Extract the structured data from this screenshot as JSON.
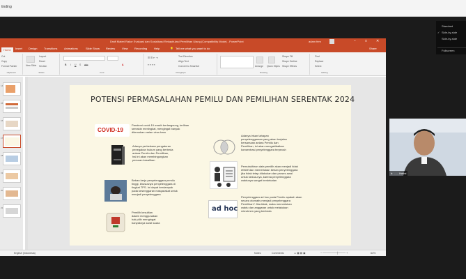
{
  "meeting": {
    "share_label": "tinding",
    "view_menu": [
      "Standard",
      "Side-by-side",
      "Side-by-side",
      "Fullscreen"
    ]
  },
  "ppt": {
    "window_title": "Draft Materi Rakor Evaluasi dan Sosialisasi Rekapitulasi Pemilihan Ulang (Compatibility Mode) - PowerPoint",
    "user_name": "adam fem",
    "window_controls": [
      "−",
      "□",
      "✕"
    ],
    "menu": [
      "File",
      "Home",
      "Insert",
      "Design",
      "Transitions",
      "Animations",
      "Slide Show",
      "Review",
      "View",
      "Recording",
      "Help",
      "Tell me what you want to do"
    ],
    "share": "Share",
    "ribbon": {
      "clipboard": [
        "Cut",
        "Copy",
        "Format Painter"
      ],
      "clipboard_label": "Clipboard",
      "slides": [
        "Layout",
        "Reset",
        "Section"
      ],
      "new_slide": "New Slide",
      "slides_label": "Slides",
      "font_label": "Font",
      "paragraph": [
        "Text Direction",
        "Align Text",
        "Convert to SmartArt"
      ],
      "paragraph_label": "Paragraph",
      "drawing": [
        "Arrange",
        "Quick Styles",
        "Shape Fill",
        "Shape Outline",
        "Shape Effects"
      ],
      "drawing_label": "Drawing",
      "editing": [
        "Find",
        "Replace",
        "Select"
      ],
      "editing_label": "Editing"
    },
    "status": {
      "lang": "English (Indonesia)",
      "notes": "Notes",
      "comments": "Comments",
      "zoom": "64%"
    },
    "thumb_numbers": [
      "14",
      "15",
      "16",
      "17",
      "18",
      "19",
      "20",
      "21"
    ]
  },
  "slide": {
    "title": "POTENSI PERMASALAHAN PEMILU DAN PEMILIHAN SERENTAK 2024",
    "covid_logo": "COVID-19",
    "adhoc_logo": "ad hoc",
    "items_left": [
      {
        "lines": [
          "Pandemi covid-19 masih berlangsung, terlihan",
          "semakin meningkat, mengingat banyak",
          "ditemukan varian virus baru"
        ]
      },
      {
        "lines": [
          "Adanya perbedaan pengaturan",
          "penegakan hukum yang berbeda",
          "antara Pemilu dan Pemilihan,",
          "hal ini akan membingungkan",
          "persoan kesalihan"
        ]
      },
      {
        "lines": [
          "Beban kerja penyelenggara pemilu",
          "tinggi, khususnya penyelenggara di",
          "tingkat TPS. Ini dapat berdampak",
          "pada kesenggaran masyarakat untuk",
          "menjadi penyelenggara"
        ]
      },
      {
        "lines": [
          "Pemilih kesulitan",
          "dalam menggunakan",
          "hak pilih mengingat",
          "banyaknya surat suara"
        ]
      }
    ],
    "items_right": [
      {
        "lines": [
          "Adanya irisan tahapan",
          "penyelenggaraan yang akan berjalan",
          "bersamaan antara Pemilu dan",
          "Pemilihan, ini akan mengakibatkan",
          "konsentrasi penyelenggara terpecah"
        ]
      },
      {
        "lines": [
          "Pemutakhiran data pemilih akan menjadi tidak",
          "efektif dan memerlukan beban penyelenggara",
          "jika tidak tetap dilakukan dan proses awal",
          "untuk kedua-nya, karena penyelenggara",
          "waktunya sangat berdekatan"
        ]
      },
      {
        "lines": [
          "Penyelenggara ad hoc pada Pemilu apakah akan",
          "secara otomatis menjadi penyelenggara",
          "Pemilihan? Jika tidak, maka memerlukan",
          "waktu dan anggaran untuk melakukan",
          "rekrutmen yang berbeda"
        ]
      }
    ]
  },
  "webcam": {
    "name": "Ir. ...... Helmi"
  },
  "colors": {
    "ppt_accent": "#c84a28",
    "slide_bg": "#fbf7e4",
    "covid_red": "#d0281d"
  }
}
